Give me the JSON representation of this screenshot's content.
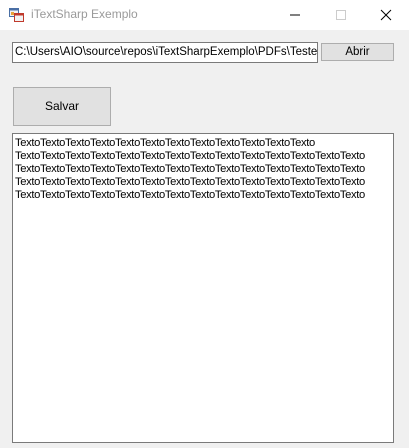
{
  "window": {
    "title": "iTextSharp Exemplo"
  },
  "path_input": {
    "value": "C:\\Users\\AIO\\source\\repos\\iTextSharpExemplo\\PDFs\\Teste."
  },
  "buttons": {
    "abrir_label": "Abrir",
    "salvar_label": "Salvar"
  },
  "text_area": {
    "lines": [
      "TextoTextoTextoTextoTextoTextoTextoTextoTextoTextoTextoTexto",
      "TextoTextoTextoTextoTextoTextoTextoTextoTextoTextoTextoTextoTextoTexto",
      "TextoTextoTextoTextoTextoTextoTextoTextoTextoTextoTextoTextoTextoTexto",
      "TextoTextoTextoTextoTextoTextoTextoTextoTextoTextoTextoTextoTextoTexto",
      "TextoTextoTextoTextoTextoTextoTextoTextoTextoTextoTextoTextoTextoTexto"
    ]
  },
  "icons": {
    "app": "winforms-app-icon",
    "minimize": "minimize-icon",
    "maximize": "maximize-icon",
    "close": "close-icon"
  }
}
